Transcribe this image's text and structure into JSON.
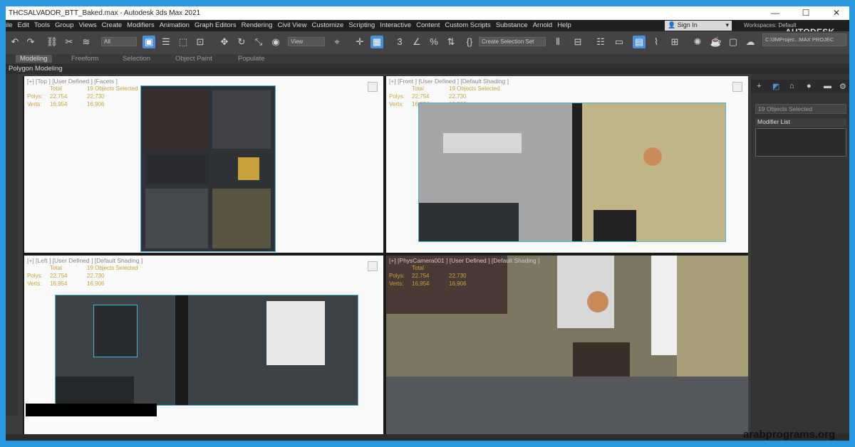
{
  "window": {
    "title": "THCSALVADOR_BTT_Baked.max - Autodesk 3ds Max 2021",
    "minimize": "—",
    "maximize": "☐",
    "close": "✕"
  },
  "menu": [
    "ile",
    "Edit",
    "Tools",
    "Group",
    "Views",
    "Create",
    "Modifiers",
    "Animation",
    "Graph Editors",
    "Rendering",
    "Civil View",
    "Customize",
    "Scripting",
    "Interactive",
    "Content",
    "Custom Scripts",
    "Substance",
    "Arnold",
    "Help"
  ],
  "account": {
    "sign_in": "Sign In",
    "workspaces_label": "Workspaces:",
    "workspace_value": "Default",
    "brand": "AUTODESK",
    "project_path": "C:\\3MProjec...MAX PROJEC"
  },
  "toolbar": {
    "selection_filter": "All",
    "reference_coord": "View",
    "selection_set": "Create Selection Set"
  },
  "ribbon": {
    "tabs": [
      "Modeling",
      "Freeform",
      "Selection",
      "Object Paint",
      "Populate"
    ],
    "active_tab": "Modeling",
    "sub": "Polygon Modeling"
  },
  "viewports": [
    {
      "label": "[+] [Top ] [User Defined ] [Facets ]",
      "selected": "19 Objects Selected",
      "total_label": "Total",
      "polys_label": "Polys:",
      "polys": "22,754",
      "polys_sel": "22,730",
      "verts_label": "Verts:",
      "verts": "16,954",
      "verts_sel": "16,906"
    },
    {
      "label": "[+] [Front ] [User Defined ] [Default Shading ]",
      "selected": "19 Objects Selected",
      "total_label": "Total",
      "polys_label": "Polys:",
      "polys": "22,754",
      "polys_sel": "22,730",
      "verts_label": "Verts:",
      "verts": "16,954",
      "verts_sel": "16,906"
    },
    {
      "label": "[+] [Left ] [User Defined ] [Default Shading ]",
      "selected": "19 Objects Selected",
      "total_label": "Total",
      "polys_label": "Polys:",
      "polys": "22,754",
      "polys_sel": "22,730",
      "verts_label": "Verts:",
      "verts": "16,954",
      "verts_sel": "16,906"
    },
    {
      "label": "[+] [PhysCamera001 ] [User Defined ] [Default Shading ]",
      "selected": "",
      "total_label": "Total",
      "polys_label": "Polys:",
      "polys": "22,754",
      "polys_sel": "22,730",
      "verts_label": "Verts:",
      "verts": "16,954",
      "verts_sel": "16,906"
    }
  ],
  "command_panel": {
    "selection_name": "19 Objects Selected",
    "modifier_list": "Modifier List"
  },
  "watermark": "arabprograms.org",
  "colors": {
    "accent": "#4a90d9",
    "outer_frame": "#2a98e0",
    "stat_text": "#c9a23a",
    "selection_outline": "#4fb3d9"
  }
}
